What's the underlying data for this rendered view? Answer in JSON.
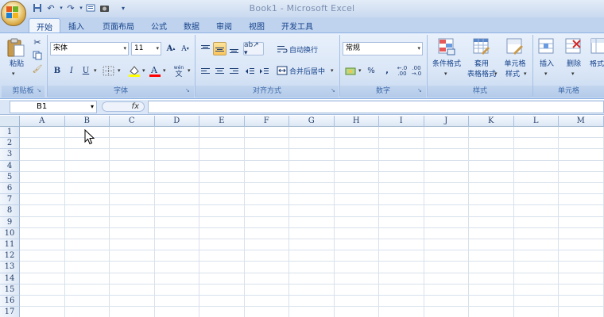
{
  "window": {
    "title": "Book1 - Microsoft Excel"
  },
  "qat": {
    "icons": [
      "save-icon",
      "undo-icon",
      "redo-icon",
      "print-preview-icon",
      "camera-icon",
      "customize-dropdown-icon"
    ]
  },
  "tabs": [
    "开始",
    "插入",
    "页面布局",
    "公式",
    "数据",
    "审阅",
    "视图",
    "开发工具"
  ],
  "active_tab": "开始",
  "ribbon": {
    "clipboard": {
      "paste_label": "粘贴",
      "group_label": "剪贴板"
    },
    "font": {
      "name": "宋体",
      "size": "11",
      "grow": "A",
      "shrink": "A",
      "bold": "B",
      "italic": "I",
      "underline": "U",
      "wen": "wén",
      "group_label": "字体",
      "font_color": "#ff0000",
      "fill_color": "#ffff00"
    },
    "alignment": {
      "wrap_label": "自动换行",
      "merge_label": "合并后居中",
      "group_label": "对齐方式"
    },
    "number": {
      "format": "常规",
      "percent": "%",
      "comma": ",",
      "group_label": "数字"
    },
    "styles": {
      "cond_format": [
        "条件格式",
        ""
      ],
      "table_format": [
        "套用",
        "表格格式"
      ],
      "cell_style": [
        "单元格",
        "样式"
      ],
      "group_label": "样式"
    },
    "cells": {
      "insert": "插入",
      "delete": "删除",
      "format": "格式",
      "group_label": "单元格"
    }
  },
  "formula_bar": {
    "name_box": "B1",
    "fx_label": "fx",
    "content": ""
  },
  "sheet": {
    "columns": [
      "A",
      "B",
      "C",
      "D",
      "E",
      "F",
      "G",
      "H",
      "I",
      "J",
      "K",
      "L",
      "M"
    ],
    "rows": [
      "1",
      "2",
      "3",
      "4",
      "5",
      "6",
      "7",
      "8",
      "9",
      "10",
      "11",
      "12",
      "13",
      "14",
      "15",
      "16",
      "17"
    ],
    "selected_cell": "B1"
  },
  "colors": {
    "accent": "#15428b",
    "ribbon_bg": "#dbe7f7",
    "active_button": "#fbc55c"
  }
}
